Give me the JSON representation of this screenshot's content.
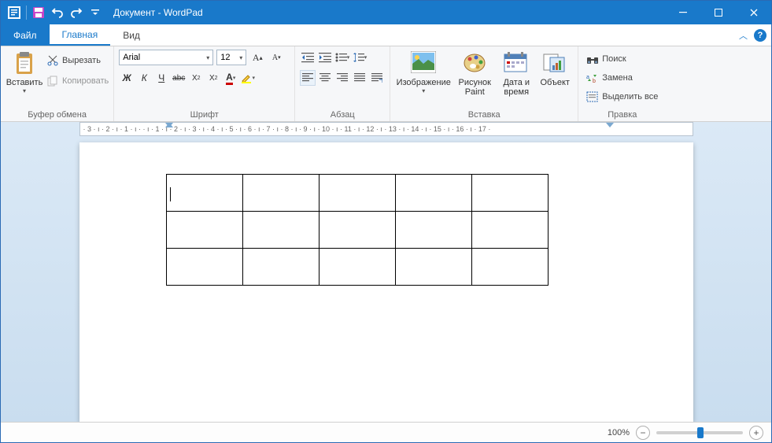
{
  "title": "Документ - WordPad",
  "tabs": {
    "file": "Файл",
    "home": "Главная",
    "view": "Вид"
  },
  "groups": {
    "clipboard": {
      "label": "Буфер обмена",
      "paste": "Вставить",
      "cut": "Вырезать",
      "copy": "Копировать"
    },
    "font": {
      "label": "Шрифт",
      "name": "Arial",
      "size": "12"
    },
    "paragraph": {
      "label": "Абзац"
    },
    "insert": {
      "label": "Вставка",
      "picture": "Изображение",
      "paint": "Рисунок Paint",
      "datetime": "Дата и время",
      "object": "Объект"
    },
    "editing": {
      "label": "Правка",
      "find": "Поиск",
      "replace": "Замена",
      "selectall": "Выделить все"
    }
  },
  "ruler_text": "· 3 · ı · 2 · ı · 1 · ı ·     · ı · 1 · ı · 2 · ı · 3 · ı · 4 · ı · 5 · ı · 6 · ı · 7 · ı · 8 · ı · 9 · ı · 10 · ı · 11 · ı · 12 · ı · 13 · ı · 14 · ı · 15 · ı · 16 · ı · 17 ·",
  "table": {
    "rows": 3,
    "cols": 5
  },
  "status": {
    "zoom": "100%"
  }
}
